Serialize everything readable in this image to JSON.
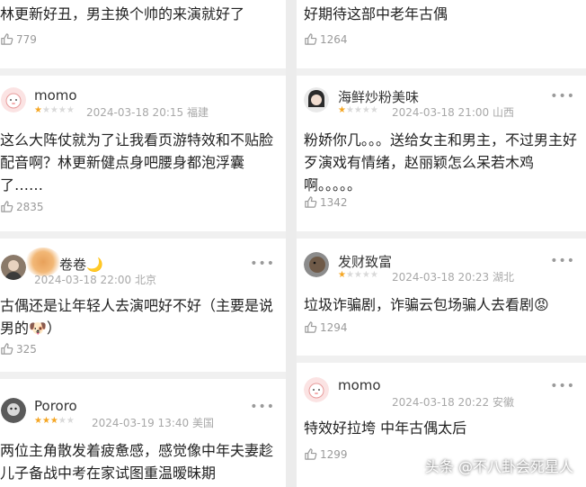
{
  "left": [
    {
      "text": "林更新好丑，男主换个帅的来演就好了",
      "likes": "779"
    },
    {
      "username": "momo",
      "rating": 1,
      "datetime": "2024-03-18 20:15",
      "location": "福建",
      "text": "这么大阵仗就为了让我看页游特效和不贴脸配音啊？林更新健点身吧腰身都泡浮囊了……",
      "likes": "2835"
    },
    {
      "username": "卷卷🌙",
      "rating": 0,
      "datetime": "2024-03-18 22:00",
      "location": "北京",
      "text": "古偶还是让年轻人去演吧好不好（主要是说男的🐶）",
      "likes": "325"
    },
    {
      "username": "Pororo",
      "rating": 3,
      "datetime": "2024-03-19 13:40",
      "location": "美国",
      "text": "两位主角散发着疲惫感，感觉像中年夫妻趁儿子备战中考在家试图重温暧昧期"
    }
  ],
  "right": [
    {
      "text": "好期待这部中老年古偶",
      "likes": "1264"
    },
    {
      "username": "海鲜炒粉美味",
      "rating": 1,
      "datetime": "2024-03-18 21:00",
      "location": "山西",
      "text": "粉娇你几。。。送给女主和男主，不过男主好歹演戏有情绪，赵丽颖怎么呆若木鸡啊。。。。。",
      "likes": "1342"
    },
    {
      "username": "发财致富",
      "rating": 1,
      "datetime": "2024-03-18 20:23",
      "location": "湖北",
      "text": "垃圾诈骗剧，诈骗云包场骗人去看剧😡",
      "likes": "1294"
    },
    {
      "username": "momo",
      "rating": 0,
      "datetime": "2024-03-18 20:22",
      "location": "安徽",
      "text": "特效好拉垮 中年古偶太后",
      "likes": "1299"
    }
  ],
  "more_label": "•••",
  "watermark": "头条 @不八卦会死星人",
  "colors": {
    "star_on": "#f5a623",
    "star_off": "#d9d9d9",
    "meta": "#a8a8a8"
  }
}
